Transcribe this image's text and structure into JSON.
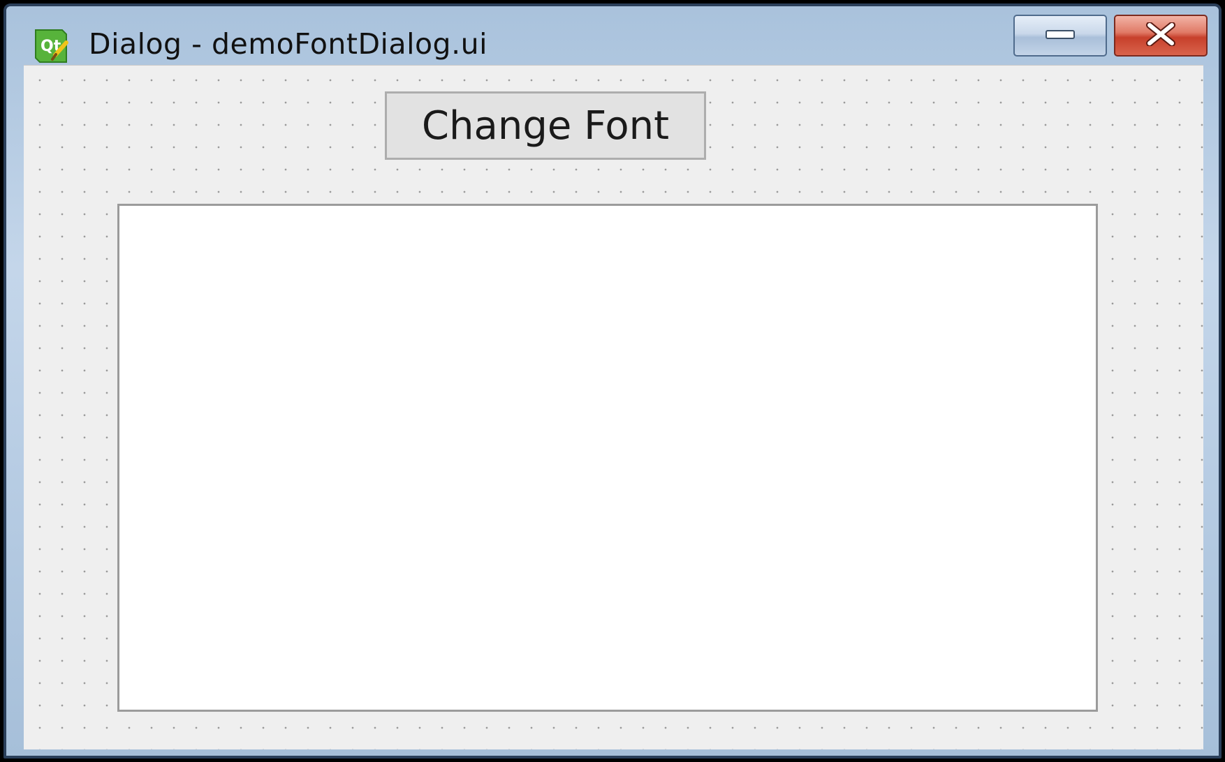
{
  "window": {
    "title": "Dialog - demoFontDialog.ui",
    "app_icon": "qt-designer-icon",
    "controls": {
      "minimize_icon": "minimize-icon",
      "close_icon": "close-icon"
    }
  },
  "dialog": {
    "change_font_label": "Change Font",
    "text_area_value": ""
  },
  "colors": {
    "canvas_background": "#efefef",
    "grid_dot": "#9a9a9a",
    "close_button": "#c7402b",
    "titlebar": "#b8cde4"
  }
}
